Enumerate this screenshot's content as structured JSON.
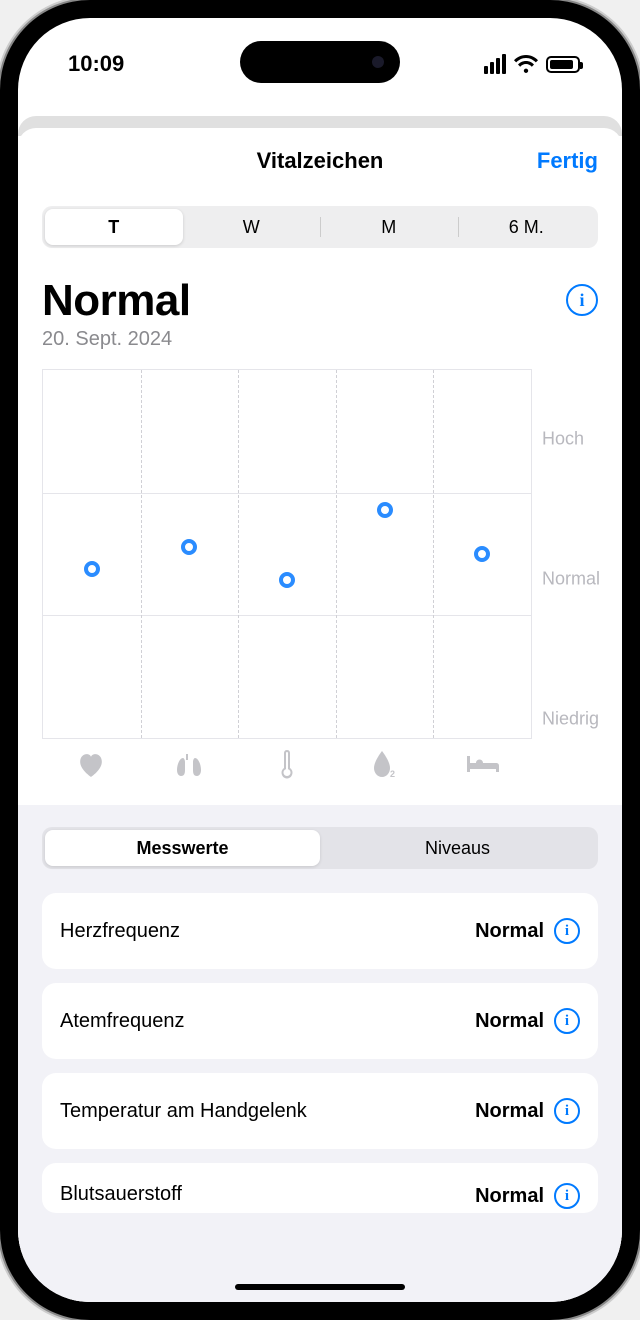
{
  "status": {
    "time": "10:09"
  },
  "nav": {
    "title": "Vitalzeichen",
    "done": "Fertig"
  },
  "range_seg": {
    "items": [
      "T",
      "W",
      "M",
      "6 M."
    ],
    "active": 0
  },
  "summary": {
    "status": "Normal",
    "date": "20. Sept. 2024"
  },
  "view_seg": {
    "items": [
      "Messwerte",
      "Niveaus"
    ],
    "active": 0
  },
  "cards": [
    {
      "title": "Herzfrequenz",
      "value": "Normal"
    },
    {
      "title": "Atemfrequenz",
      "value": "Normal"
    },
    {
      "title": "Temperatur am Handgelenk",
      "value": "Normal"
    },
    {
      "title": "Blutsauerstoff",
      "value": "Normal"
    }
  ],
  "chart_data": {
    "type": "scatter",
    "categories": [
      "heart",
      "lungs",
      "thermometer",
      "oxygen",
      "bed"
    ],
    "y_levels": [
      "Niedrig",
      "Normal",
      "Hoch"
    ],
    "series": [
      {
        "name": "Vitalzeichen",
        "values": [
          "Normal",
          "Normal",
          "Normal",
          "Normal",
          "Normal"
        ],
        "offsets": [
          0.45,
          0.55,
          0.4,
          0.75,
          0.52
        ]
      }
    ],
    "y_label_high": "Hoch",
    "y_label_normal": "Normal",
    "y_label_low": "Niedrig"
  }
}
